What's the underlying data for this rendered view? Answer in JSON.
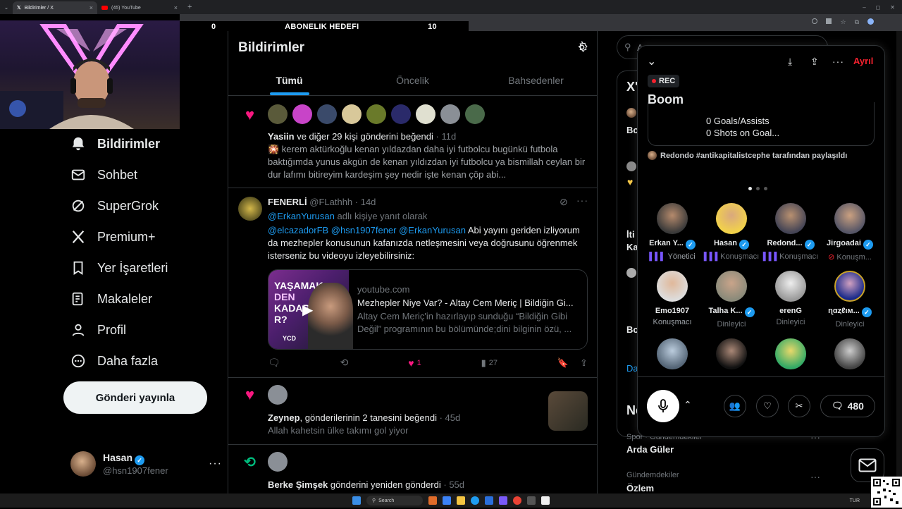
{
  "browser": {
    "tabs": [
      {
        "label": "Bildirimler / X",
        "icon": "x-logo-icon"
      },
      {
        "label": "(45) YouTube",
        "icon": "youtube-icon"
      }
    ]
  },
  "stream_overlay": {
    "left": "0",
    "center": "ABONELIK HEDEFI",
    "right": "10"
  },
  "sidebar": {
    "items": [
      {
        "label": "Bildirimler",
        "icon": "bell-icon",
        "active": true
      },
      {
        "label": "Sohbet",
        "icon": "mail-icon"
      },
      {
        "label": "SuperGrok",
        "icon": "grok-icon"
      },
      {
        "label": "Premium+",
        "icon": "x-logo-icon"
      },
      {
        "label": "Yer İşaretleri",
        "icon": "bookmark-icon"
      },
      {
        "label": "Makaleler",
        "icon": "article-icon"
      },
      {
        "label": "Profil",
        "icon": "person-icon"
      },
      {
        "label": "Daha fazla",
        "icon": "more-circle-icon"
      }
    ],
    "post_button": "Gönderi yayınla",
    "account": {
      "name": "Hasan",
      "handle": "@hsn1907fener"
    }
  },
  "main": {
    "title": "Bildirimler",
    "tabs": [
      "Tümü",
      "Öncelik",
      "Bahsedenler"
    ],
    "notif1": {
      "actor": "Yasiin",
      "action": "ve diğer 29 kişi gönderini beğendi",
      "time": "· 11d",
      "text": "🎇 kerem aktürkoğlu kenan yıldazdan daha iyi futbolcu bugünkü futbola baktığımda yunus akgün de kenan yıldızdan iyi futbolcu ya bismillah ceylan bir dur lafımı bitireyim kardeşim şey nedir işte kenan çöp abi..."
    },
    "reply": {
      "name": "FENERLİ",
      "handle": "@FLathhh",
      "time": "· 14d",
      "replying_user": "@ErkanYurusan",
      "replying_suffix": "adlı kişiye yanıt olarak",
      "mentions": "@elcazadorFB @hsn1907fener @ErkanYurusan",
      "text": "Abi yayını geriden izliyorum da mezhepler konusunun kafanızda netleşmesini veya doğrusunu öğrenmek isterseniz bu videoyu izleyebilirsiniz:",
      "card": {
        "domain": "youtube.com",
        "title": "Mezhepler Niye Var? - Altay Cem Meriç | Bildiğin Gi...",
        "desc": "Altay Cem Meriç'in hazırlayıp sunduğu “Bildiğin Gibi Değil” programının bu bölümünde;dini bilginin özü, ...",
        "thumb_text1": "YAŞAMAK",
        "thumb_text2": "DEN",
        "thumb_text3": "KADAR",
        "thumb_text4": "R?",
        "thumb_badge": "YCD"
      },
      "likes": "1",
      "views": "27"
    },
    "notif2": {
      "actor": "Zeynep",
      "action": "gönderilerinin 2 tanesini beğendi",
      "time": "· 45d",
      "text": "Allah kahetsin ülke takımı gol yiyor"
    },
    "notif3": {
      "actor": "Berke Şimşek",
      "action": "gönderini yeniden gönderdi",
      "time": "· 55d"
    }
  },
  "right": {
    "search_placeholder": "A",
    "behind_letters": [
      "X'",
      "Bo",
      "İti",
      "Ka",
      "Bo",
      "Da"
    ],
    "trends": [
      {
        "category": "Spor · Gündemdekiler",
        "name": "Arda Güler"
      },
      {
        "category": "Gündemdekiler",
        "name": "Özlem"
      }
    ],
    "trends_header": "Ne"
  },
  "space": {
    "rec": "REC",
    "title": "Boom",
    "leave": "Ayrıl",
    "pinned_lines": [
      "0 Goals/Assists",
      "0 Shots on Goal..."
    ],
    "shared_by": "Redondo #antikapitalistcephe tarafından paylaşıldı",
    "speakers": [
      {
        "name": "Erkan Y...",
        "role": "Yönetici",
        "verified": true
      },
      {
        "name": "Hasan",
        "role": "Konuşmacı",
        "verified": true
      },
      {
        "name": "Redond...",
        "role": "Konuşmacı",
        "verified": true
      },
      {
        "name": "Jirgoadai",
        "role": "Konuşm...",
        "verified": true
      },
      {
        "name": "Emo1907",
        "role": "Konuşmacı",
        "verified": false
      },
      {
        "name": "Talha K...",
        "role": "Dinleyici",
        "verified": true
      },
      {
        "name": "erenG",
        "role": "Dinleyici",
        "verified": false
      },
      {
        "name": "ɳαȥℓιм...",
        "role": "Dinleyici",
        "verified": true
      }
    ],
    "comment_count": "480"
  },
  "taskbar": {
    "search": "Search",
    "lang": "TUR"
  },
  "colors": {
    "accent": "#1d9bf0",
    "like": "#f91880",
    "retweet": "#00ba7c",
    "leave": "#f4212e"
  }
}
